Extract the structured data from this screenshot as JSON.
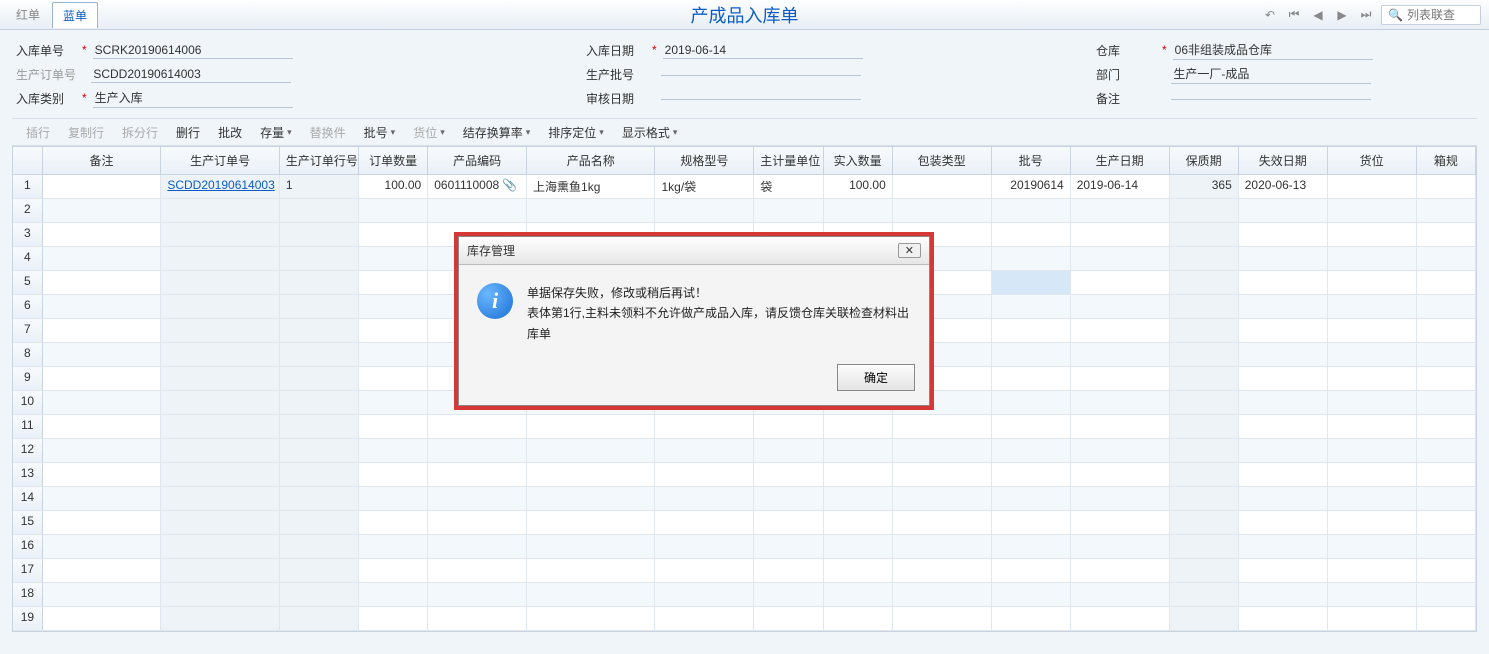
{
  "header": {
    "tab_red": "红单",
    "tab_blue": "蓝单",
    "title": "产成品入库单",
    "search_placeholder": "列表联查"
  },
  "form": {
    "row1": {
      "f1_label": "入库单号",
      "f1_value": "SCRK20190614006",
      "f2_label": "入库日期",
      "f2_value": "2019-06-14",
      "f3_label": "仓库",
      "f3_value": "06非组装成品仓库"
    },
    "row2": {
      "f1_label": "生产订单号",
      "f1_value": "SCDD20190614003",
      "f2_label": "生产批号",
      "f2_value": "",
      "f3_label": "部门",
      "f3_value": "生产一厂-成品"
    },
    "row3": {
      "f1_label": "入库类别",
      "f1_value": "生产入库",
      "f2_label": "审核日期",
      "f2_value": "",
      "f3_label": "备注",
      "f3_value": ""
    }
  },
  "toolbar": {
    "insert": "插行",
    "copy": "复制行",
    "split": "拆分行",
    "delete": "删行",
    "batch": "批改",
    "stock": "存量",
    "replace": "替换件",
    "batchno": "批号",
    "loc": "货位",
    "convert": "结存换算率",
    "sort": "排序定位",
    "disp": "显示格式"
  },
  "columns": {
    "remark": "备注",
    "order": "生产订单号",
    "orderline": "生产订单行号",
    "qty": "订单数量",
    "code": "产品编码",
    "name": "产品名称",
    "spec": "规格型号",
    "unit": "主计量单位",
    "inqty": "实入数量",
    "pack": "包装类型",
    "batch": "批号",
    "pdate": "生产日期",
    "shelf": "保质期",
    "exp": "失效日期",
    "loc": "货位",
    "box": "箱规"
  },
  "row1": {
    "order": "SCDD20190614003",
    "orderline": "1",
    "qty": "100.00",
    "code": "0601110008",
    "name": "上海熏鱼1kg",
    "spec": "1kg/袋",
    "unit": "袋",
    "inqty": "100.00",
    "batch": "20190614",
    "pdate": "2019-06-14",
    "shelf": "365",
    "exp": "2020-06-13"
  },
  "dialog": {
    "title": "库存管理",
    "line1": "单据保存失败，修改或稍后再试！",
    "line2": "表体第1行,主料未领料不允许做产成品入库，请反馈仓库关联检查材料出库单",
    "ok": "确定"
  }
}
